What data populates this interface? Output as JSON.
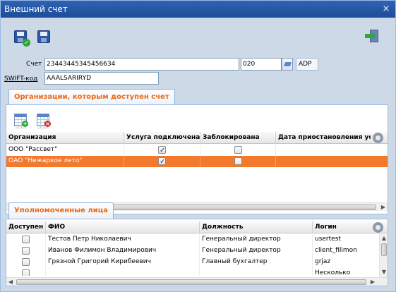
{
  "window": {
    "title": "Внешний счет",
    "close_glyph": "×"
  },
  "toolbar": {
    "save_close_icon": "save-and-close-icon",
    "save_icon": "save-icon",
    "exit_icon": "exit-icon"
  },
  "account": {
    "label": "Счет",
    "number": "23443445345456634",
    "code": "020",
    "currency": "ADP"
  },
  "swift": {
    "label": "SWIFT-код",
    "value": "AAALSARIRYD"
  },
  "org_tab": {
    "label": "Организации, которым доступен счет"
  },
  "org_grid": {
    "columns": [
      "Организация",
      "Услуга подключена",
      "Заблокирована",
      "Дата приостановления ус"
    ],
    "rows": [
      {
        "name": "ООО \"Рассвет\"",
        "service": true,
        "blocked": false,
        "date": ""
      },
      {
        "name": "ОАО \"Нежаркое лето\"",
        "service": true,
        "blocked": false,
        "date": ""
      }
    ]
  },
  "persons_tab": {
    "label": "Уполномоченные лица"
  },
  "persons_grid": {
    "columns": [
      "Доступен",
      "ФИО",
      "Должность",
      "Логин"
    ],
    "rows": [
      {
        "access": false,
        "fio": "Тестов Петр Николаевич",
        "position": "Генеральный директор",
        "login": "usertest"
      },
      {
        "access": false,
        "fio": "Иванов Филимон Владимирович",
        "position": "Генеральный директор",
        "login": "client_filimon"
      },
      {
        "access": false,
        "fio": "Грязной Григорий Кирибеевич",
        "position": "Главный бухгалтер",
        "login": "grjaz"
      },
      {
        "access": false,
        "fio": "",
        "position": "",
        "login": "Несколько"
      }
    ]
  },
  "colors": {
    "title_bar": "#2f63b3",
    "accent_orange": "#e76a17",
    "selected_row": "#f3792c"
  }
}
